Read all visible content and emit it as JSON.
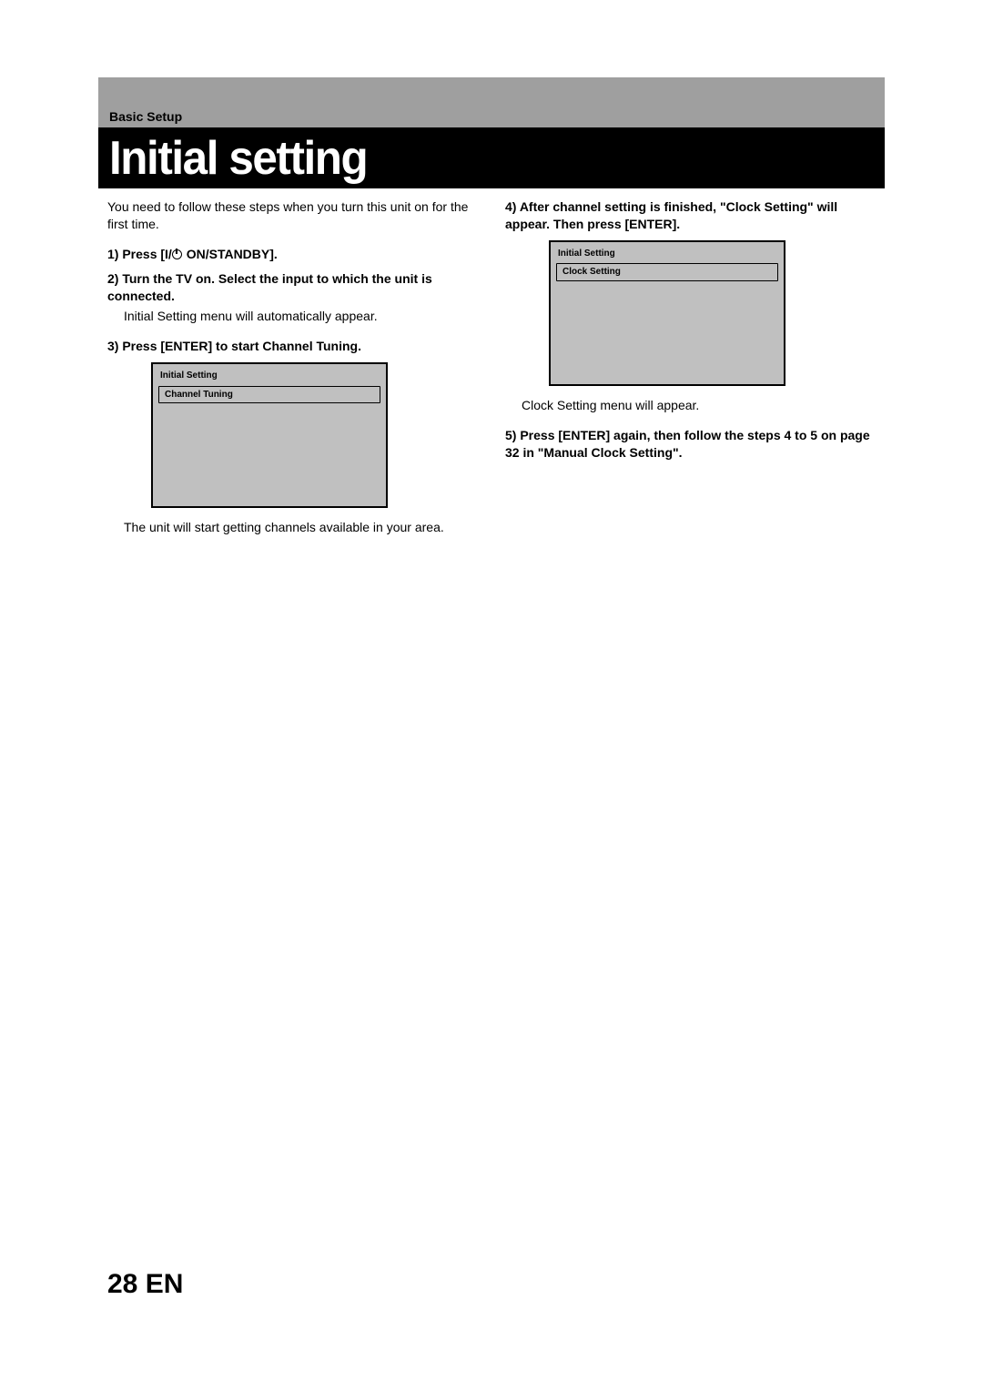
{
  "section": "Basic Setup",
  "title": "Initial setting",
  "intro": "You need to follow these steps when you turn this unit on for the first time.",
  "step1_pre": "1) Press [I/",
  "step1_post": " ON/STANDBY].",
  "step2": "2) Turn the TV on. Select the input to which the unit is connected.",
  "step2_note": "Initial Setting menu will automatically appear.",
  "step3": "3) Press [ENTER] to start Channel Tuning.",
  "menu_left_title": "Initial Setting",
  "menu_left_item": "Channel Tuning",
  "step3_note": "The unit will start getting channels available in your area.",
  "step4": "4) After channel setting is finished, \"Clock Setting\" will appear. Then press [ENTER].",
  "menu_right_title": "Initial Setting",
  "menu_right_item": "Clock Setting",
  "step4_note": "Clock Setting menu will appear.",
  "step5": "5) Press [ENTER] again, then follow the steps 4 to 5 on page 32 in \"Manual Clock Setting\".",
  "page_num": "28",
  "lang": "EN"
}
